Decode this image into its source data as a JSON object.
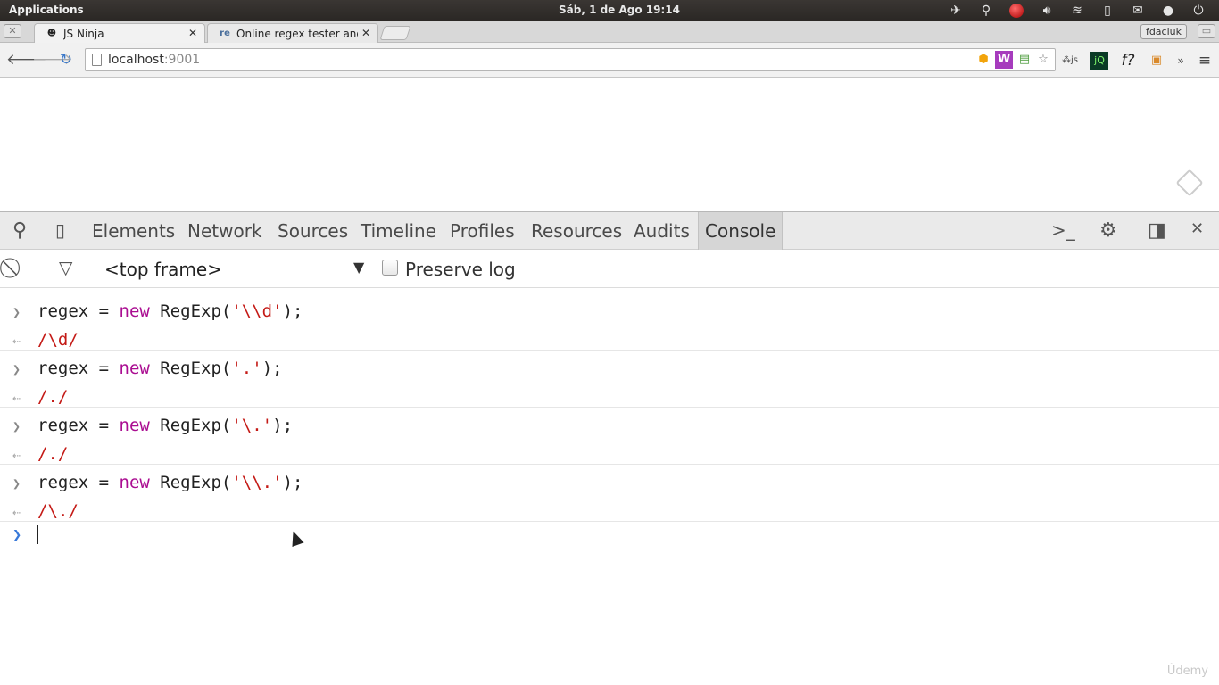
{
  "os_bar": {
    "applications_label": "Applications",
    "clock": "Sáb,  1 de Ago 19:14"
  },
  "tabs": [
    {
      "title": "JS Ninja",
      "favicon": "ninja-icon"
    },
    {
      "title": "Online regex tester and d",
      "favicon": "regex101-icon",
      "favicon_text": "re"
    }
  ],
  "profile_name": "fdaciuk",
  "toolbar": {
    "url_host": "localhost",
    "url_port": ":9001"
  },
  "devtools": {
    "tabs": [
      "Elements",
      "Network",
      "Sources",
      "Timeline",
      "Profiles",
      "Resources",
      "Audits",
      "Console"
    ],
    "active_tab": "Console",
    "frame_selector": "<top frame>",
    "preserve_log_label": "Preserve log",
    "preserve_log_checked": false
  },
  "console": {
    "entries": [
      {
        "input_prefix": "regex = ",
        "input_keyword": "new",
        "input_call": " RegExp(",
        "input_string": "'\\\\d'",
        "input_suffix": ");",
        "output": "/\\d/"
      },
      {
        "input_prefix": "regex = ",
        "input_keyword": "new",
        "input_call": " RegExp(",
        "input_string": "'.'",
        "input_suffix": ");",
        "output": "/./"
      },
      {
        "input_prefix": "regex = ",
        "input_keyword": "new",
        "input_call": " RegExp(",
        "input_string": "'\\.'",
        "input_suffix": ");",
        "output": "/./"
      },
      {
        "input_prefix": "regex = ",
        "input_keyword": "new",
        "input_call": " RegExp(",
        "input_string": "'\\\\.'",
        "input_suffix": ");",
        "output": "/\\./"
      }
    ]
  },
  "watermark": "Ûdemy"
}
